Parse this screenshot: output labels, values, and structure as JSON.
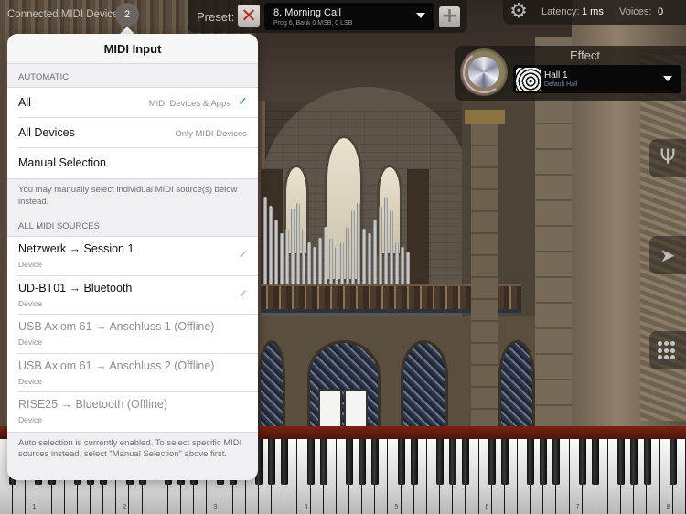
{
  "topbar": {
    "connected_label": "Connected MIDI Devices:",
    "connected_count": "2",
    "preset_label": "Preset:",
    "preset_remove_icon": "✕",
    "preset_name": "8. Morning Call",
    "preset_details": "Prog 6, Bank 0 MSB, 0 LSB",
    "preset_add_icon": "+",
    "latency_label": "Latency:",
    "latency_value": "1 ms",
    "voices_label": "Voices:",
    "voices_value": "0",
    "settings_icon": "⚙"
  },
  "effect": {
    "title": "Effect",
    "name": "Hall 1",
    "description": "Default Hall"
  },
  "side_buttons": {
    "tuner_icon": "Ψ",
    "arrow_icon": "➤"
  },
  "popover": {
    "title": "MIDI Input",
    "automatic_header": "AUTOMATIC",
    "automatic_options": [
      {
        "label": "All",
        "detail": "MIDI Devices & Apps",
        "selected": true
      },
      {
        "label": "All Devices",
        "detail": "Only MIDI Devices",
        "selected": false
      },
      {
        "label": "Manual Selection",
        "detail": "",
        "selected": false
      }
    ],
    "automatic_footer": "You may manually select individual MIDI source(s) below instead.",
    "sources_header": "ALL MIDI SOURCES",
    "sources": [
      {
        "name": "Netzwerk → Session 1",
        "type": "Device",
        "checked": true,
        "offline": false
      },
      {
        "name": "UD-BT01 → Bluetooth",
        "type": "Device",
        "checked": true,
        "offline": false
      },
      {
        "name": "USB Axiom 61 → Anschluss 1 (Offline)",
        "type": "Device",
        "checked": false,
        "offline": true
      },
      {
        "name": "USB Axiom 61 → Anschluss 2 (Offline)",
        "type": "Device",
        "checked": false,
        "offline": true
      },
      {
        "name": "RISE25  → Bluetooth (Offline)",
        "type": "Device",
        "checked": false,
        "offline": true
      }
    ],
    "sources_footer": "Auto selection is currently enabled. To select specific MIDI sources instead, select \"Manual Selection\" above first.",
    "check_glyph": "✓",
    "accent_color": "#2a72e8"
  },
  "keyboard": {
    "octave_labels": [
      "1",
      "2",
      "3",
      "4",
      "5",
      "6",
      "7",
      "8"
    ]
  }
}
